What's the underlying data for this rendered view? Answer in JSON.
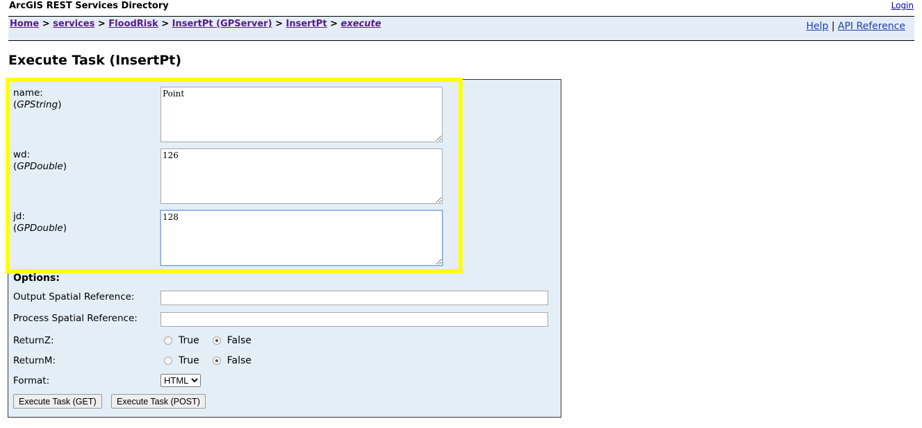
{
  "header": {
    "title": "ArcGIS REST Services Directory",
    "login": "Login"
  },
  "breadcrumb": [
    "Home",
    "services",
    "FloodRisk",
    "InsertPt (GPServer)",
    "InsertPt",
    "execute"
  ],
  "separator": ">",
  "links": {
    "help": "Help",
    "sep": "|",
    "api": "API Reference"
  },
  "page_title": "Execute Task (InsertPt)",
  "params": [
    {
      "name": "name:",
      "type": "GPString",
      "value": "Point"
    },
    {
      "name": "wd:",
      "type": "GPDouble",
      "value": "126"
    },
    {
      "name": "jd:",
      "type": "GPDouble",
      "value": "128"
    }
  ],
  "options": {
    "heading": "Options:",
    "out_sr": "Output Spatial Reference:",
    "proc_sr": "Process Spatial Reference:",
    "returnz": "ReturnZ:",
    "returnm": "ReturnM:",
    "true_label": "True",
    "false_label": "False",
    "returnz_value": "False",
    "returnm_value": "False",
    "format": "Format:",
    "format_value": "HTML"
  },
  "buttons": {
    "get": "Execute Task (GET)",
    "post": "Execute Task (POST)"
  },
  "colors": {
    "highlight": "#ffff00",
    "panel": "#e4eef7"
  }
}
